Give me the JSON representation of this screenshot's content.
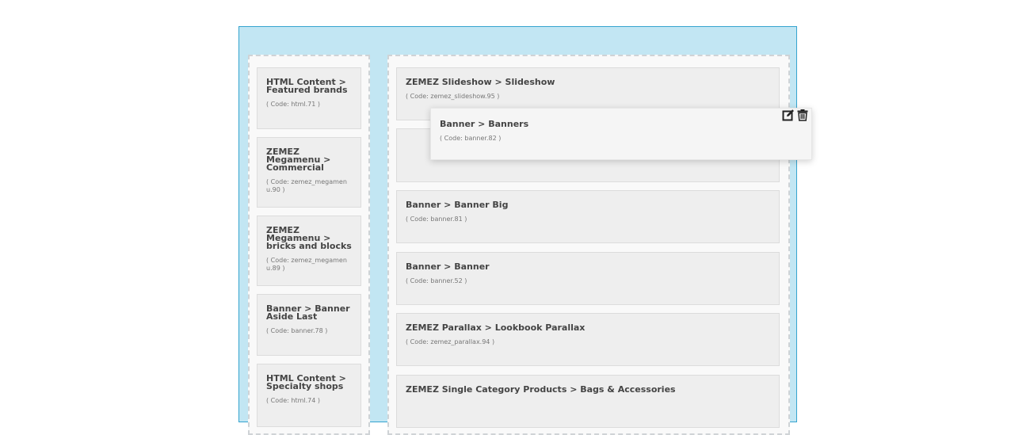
{
  "left_column": {
    "modules": [
      {
        "title": "HTML Content > Featured brands",
        "code": "( Code: html.71 )"
      },
      {
        "title": "ZEMEZ Megamenu > Commercial",
        "code": "( Code: zemez_megamenu.90 )"
      },
      {
        "title": "ZEMEZ Megamenu > bricks and blocks",
        "code": "( Code: zemez_megamenu.89 )"
      },
      {
        "title": "Banner > Banner Aside Last",
        "code": "( Code: banner.78 )"
      },
      {
        "title": "HTML Content > Specialty shops",
        "code": "( Code: html.74 )"
      }
    ]
  },
  "right_column": {
    "modules": [
      {
        "title": "ZEMEZ Slideshow > Slideshow",
        "code": "( Code: zemez_slideshow.95 )"
      },
      {
        "title": "Banner > Banner Big",
        "code": "( Code: banner.81 )"
      },
      {
        "title": "Banner > Banner",
        "code": "( Code: banner.52 )"
      },
      {
        "title": "ZEMEZ Parallax > Lookbook Parallax",
        "code": "( Code: zemez_parallax.94 )"
      },
      {
        "title": "ZEMEZ Single Category Products > Bags & Accessories",
        "code": ""
      }
    ]
  },
  "dragging_module": {
    "title": "Banner > Banners",
    "code": "( Code: banner.82 )",
    "edit_icon": "edit-icon",
    "delete_icon": "trash-icon"
  }
}
